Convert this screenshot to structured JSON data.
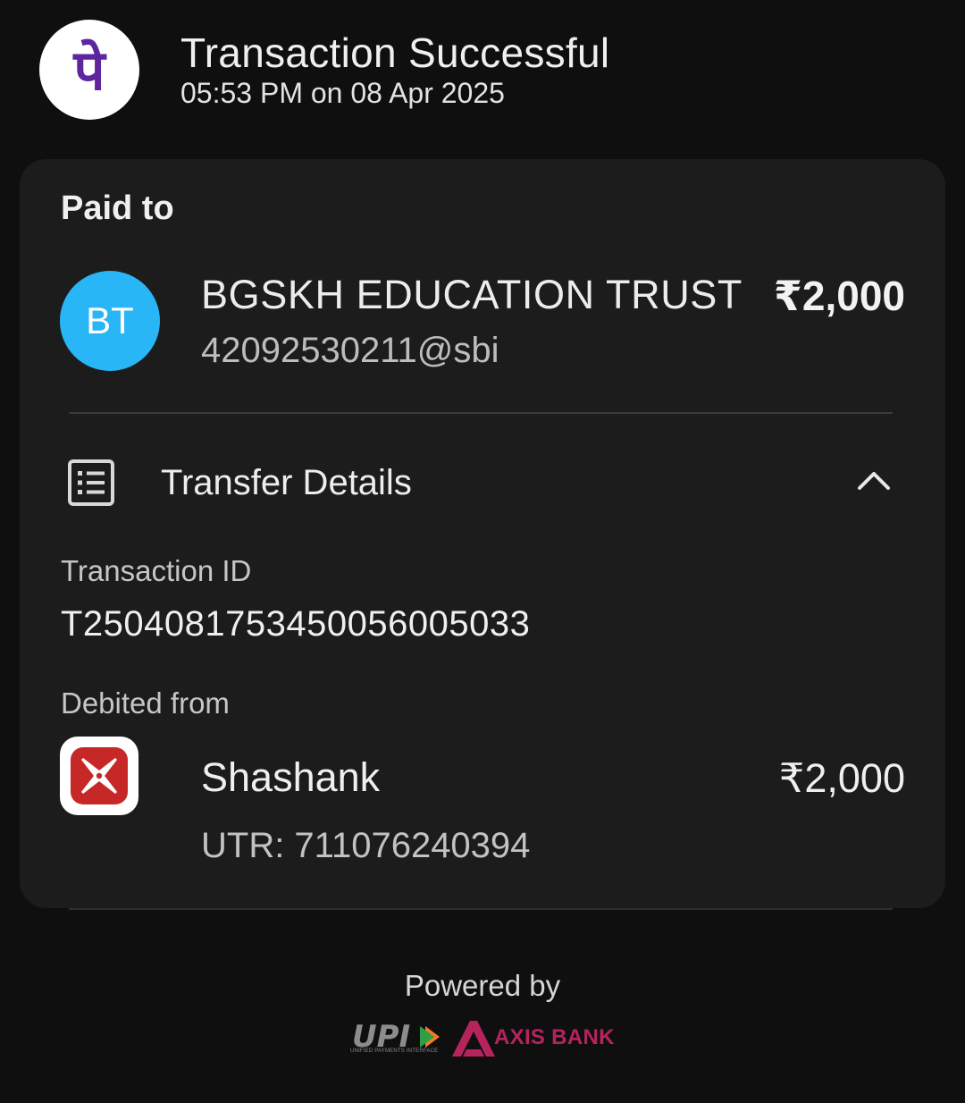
{
  "header": {
    "title": "Transaction Successful",
    "timestamp": "05:53 PM on 08 Apr 2025",
    "app_logo_glyph": "पे",
    "app_logo_color": "#5f259f"
  },
  "paid_to": {
    "label": "Paid to",
    "avatar_initials": "BT",
    "avatar_color": "#29b6f6",
    "name": "BGSKH EDUCATION TRUST",
    "upi_id": "42092530211@sbi",
    "amount": "₹2,000"
  },
  "transfer_details": {
    "title": "Transfer Details",
    "icon": "receipt-list-icon",
    "toggle_icon": "chevron-up-icon",
    "transaction_id_label": "Transaction ID",
    "transaction_id": "T2504081753450056005033",
    "debited_from_label": "Debited from",
    "account": {
      "bank_icon": "bank-logo-icon",
      "bank_color": "#c62828",
      "name": "Shashank",
      "amount": "₹2,000",
      "utr": "UTR: 711076240394"
    }
  },
  "footer": {
    "powered_by": "Powered by",
    "upi_logo_text": "UPI",
    "upi_subtitle": "UNIFIED PAYMENTS INTERFACE",
    "partner_bank": "AXIS BANK",
    "partner_color": "#b5245c"
  }
}
